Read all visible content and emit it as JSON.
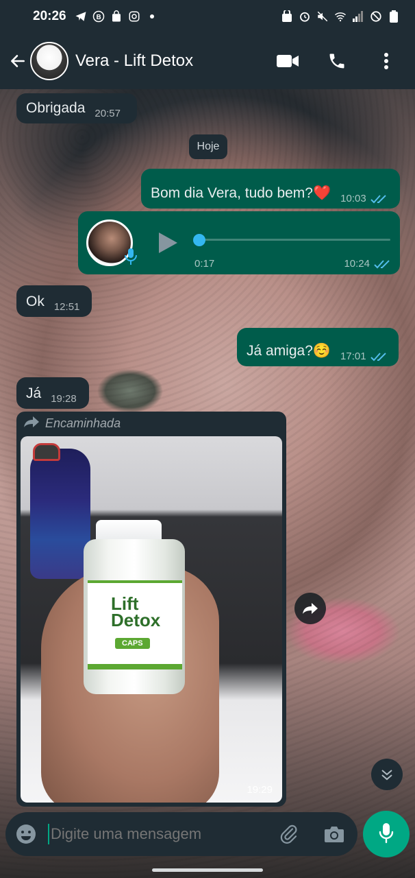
{
  "status_bar": {
    "time": "20:26",
    "left_icons": [
      "telegram-icon",
      "b-circle-icon",
      "shopping-bag-icon",
      "instagram-icon",
      "dot-icon"
    ],
    "right_icons": [
      "bag-lock-icon",
      "alarm-icon",
      "mute-icon",
      "wifi-icon",
      "signal-icon",
      "dnd-icon",
      "battery-icon"
    ]
  },
  "header": {
    "contact_name": "Vera - Lift Detox",
    "actions": [
      "video-call-icon",
      "phone-call-icon",
      "more-options-icon"
    ]
  },
  "messages": [
    {
      "direction": "in",
      "text": "Obrigada",
      "time": "20:57"
    },
    {
      "direction": "out",
      "text": "Bom dia Vera, tudo bem?❤️",
      "time": "10:03",
      "status": "read"
    },
    {
      "direction": "out",
      "type": "audio",
      "duration": "0:17",
      "time": "10:24",
      "status": "read",
      "progress": 0
    },
    {
      "direction": "in",
      "text": "Ok",
      "time": "12:51"
    },
    {
      "direction": "out",
      "text": "Já amiga?☺️",
      "time": "17:01",
      "status": "read"
    },
    {
      "direction": "in",
      "text": "Já",
      "time": "19:28"
    },
    {
      "direction": "in",
      "type": "image",
      "forwarded_label": "Encaminhada",
      "time": "19:29"
    }
  ],
  "date_separator": "Hoje",
  "photo": {
    "product_brand_line1": "Lift",
    "product_brand_line2": "Detox",
    "product_sub": "CAPS"
  },
  "input": {
    "placeholder": "Digite uma mensagem"
  },
  "colors": {
    "header_bg": "#1f2c34",
    "incoming_bubble": "#1f2c34",
    "outgoing_bubble": "#005c4b",
    "read_tick": "#53bdeb",
    "accent": "#00a884"
  }
}
